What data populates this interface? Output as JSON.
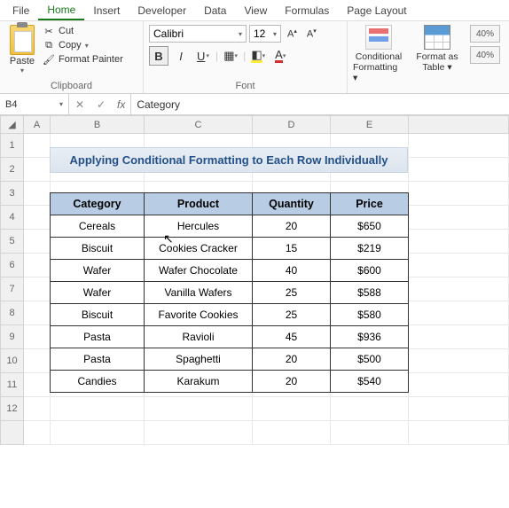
{
  "menu": [
    "File",
    "Home",
    "Insert",
    "Developer",
    "Data",
    "View",
    "Formulas",
    "Page Layout"
  ],
  "active_menu": 1,
  "clipboard": {
    "paste": "Paste",
    "cut": "Cut",
    "copy": "Copy",
    "painter": "Format Painter",
    "group": "Clipboard"
  },
  "font": {
    "name": "Calibri",
    "size": "12",
    "group": "Font"
  },
  "styles": {
    "cond": "Conditional Formatting",
    "table": "Format as Table",
    "pct": "40%"
  },
  "cell_ref": "B4",
  "formula_value": "Category",
  "columns": [
    "A",
    "B",
    "C",
    "D",
    "E"
  ],
  "title": "Applying Conditional Formatting to Each Row Individually",
  "headers": [
    "Category",
    "Product",
    "Quantity",
    "Price"
  ],
  "rows": [
    {
      "cat": "Cereals",
      "prod": "Hercules",
      "qty": "20",
      "price": "$650"
    },
    {
      "cat": "Biscuit",
      "prod": "Cookies Cracker",
      "qty": "15",
      "price": "$219"
    },
    {
      "cat": "Wafer",
      "prod": "Wafer Chocolate",
      "qty": "40",
      "price": "$600"
    },
    {
      "cat": "Wafer",
      "prod": "Vanilla Wafers",
      "qty": "25",
      "price": "$588"
    },
    {
      "cat": "Biscuit",
      "prod": "Favorite Cookies",
      "qty": "25",
      "price": "$580"
    },
    {
      "cat": "Pasta",
      "prod": "Ravioli",
      "qty": "45",
      "price": "$936"
    },
    {
      "cat": "Pasta",
      "prod": "Spaghetti",
      "qty": "20",
      "price": "$500"
    },
    {
      "cat": "Candies",
      "prod": "Karakum",
      "qty": "20",
      "price": "$540"
    }
  ],
  "chart_data": {
    "type": "table",
    "title": "Applying Conditional Formatting to Each Row Individually",
    "columns": [
      "Category",
      "Product",
      "Quantity",
      "Price"
    ],
    "data": [
      [
        "Cereals",
        "Hercules",
        20,
        650
      ],
      [
        "Biscuit",
        "Cookies Cracker",
        15,
        219
      ],
      [
        "Wafer",
        "Wafer Chocolate",
        40,
        600
      ],
      [
        "Wafer",
        "Vanilla Wafers",
        25,
        588
      ],
      [
        "Biscuit",
        "Favorite Cookies",
        25,
        580
      ],
      [
        "Pasta",
        "Ravioli",
        45,
        936
      ],
      [
        "Pasta",
        "Spaghetti",
        20,
        500
      ],
      [
        "Candies",
        "Karakum",
        20,
        540
      ]
    ]
  }
}
